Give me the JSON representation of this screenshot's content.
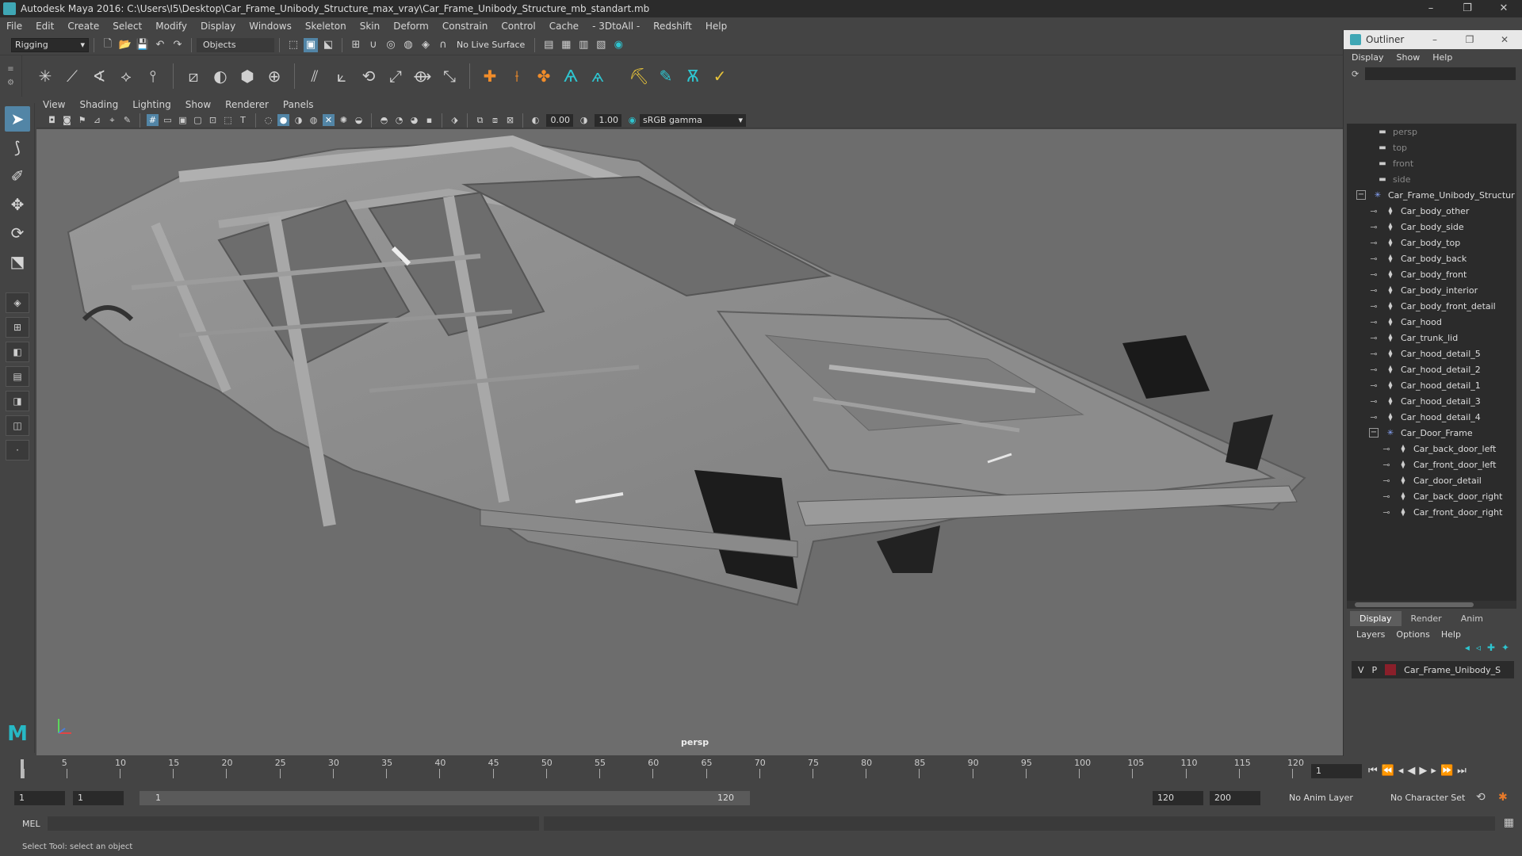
{
  "window": {
    "title": "Autodesk Maya 2016: C:\\Users\\I5\\Desktop\\Car_Frame_Unibody_Structure_max_vray\\Car_Frame_Unibody_Structure_mb_standart.mb",
    "minimize": "–",
    "maximize": "❐",
    "close": "✕"
  },
  "menubar": [
    "File",
    "Edit",
    "Create",
    "Select",
    "Modify",
    "Display",
    "Windows",
    "Skeleton",
    "Skin",
    "Deform",
    "Constrain",
    "Control",
    "Cache",
    "- 3DtoAll -",
    "Redshift",
    "Help"
  ],
  "statusline": {
    "menuset": "Rigging",
    "object_field": "Objects",
    "live_surface": "No Live Surface"
  },
  "viewport": {
    "menu": [
      "View",
      "Shading",
      "Lighting",
      "Show",
      "Renderer",
      "Panels"
    ],
    "gamma_value": "0.00",
    "exposure_value": "1.00",
    "color_space": "sRGB gamma",
    "camera_label": "persp"
  },
  "outliner": {
    "title": "Outliner",
    "menu": [
      "Display",
      "Show",
      "Help"
    ],
    "items": [
      {
        "label": "persp",
        "level": 0,
        "kind": "camera",
        "dim": true
      },
      {
        "label": "top",
        "level": 0,
        "kind": "camera",
        "dim": true
      },
      {
        "label": "front",
        "level": 0,
        "kind": "camera",
        "dim": true
      },
      {
        "label": "side",
        "level": 0,
        "kind": "camera",
        "dim": true
      },
      {
        "label": "Car_Frame_Unibody_Structur",
        "level": 0,
        "kind": "group",
        "dim": false
      },
      {
        "label": "Car_body_other",
        "level": 1,
        "kind": "mesh",
        "dim": false
      },
      {
        "label": "Car_body_side",
        "level": 1,
        "kind": "mesh",
        "dim": false
      },
      {
        "label": "Car_body_top",
        "level": 1,
        "kind": "mesh",
        "dim": false
      },
      {
        "label": "Car_body_back",
        "level": 1,
        "kind": "mesh",
        "dim": false
      },
      {
        "label": "Car_body_front",
        "level": 1,
        "kind": "mesh",
        "dim": false
      },
      {
        "label": "Car_body_interior",
        "level": 1,
        "kind": "mesh",
        "dim": false
      },
      {
        "label": "Car_body_front_detail",
        "level": 1,
        "kind": "mesh",
        "dim": false
      },
      {
        "label": "Car_hood",
        "level": 1,
        "kind": "mesh",
        "dim": false
      },
      {
        "label": "Car_trunk_lid",
        "level": 1,
        "kind": "mesh",
        "dim": false
      },
      {
        "label": "Car_hood_detail_5",
        "level": 1,
        "kind": "mesh",
        "dim": false
      },
      {
        "label": "Car_hood_detail_2",
        "level": 1,
        "kind": "mesh",
        "dim": false
      },
      {
        "label": "Car_hood_detail_1",
        "level": 1,
        "kind": "mesh",
        "dim": false
      },
      {
        "label": "Car_hood_detail_3",
        "level": 1,
        "kind": "mesh",
        "dim": false
      },
      {
        "label": "Car_hood_detail_4",
        "level": 1,
        "kind": "mesh",
        "dim": false
      },
      {
        "label": "Car_Door_Frame",
        "level": 1,
        "kind": "group",
        "dim": false
      },
      {
        "label": "Car_back_door_left",
        "level": 2,
        "kind": "mesh",
        "dim": false
      },
      {
        "label": "Car_front_door_left",
        "level": 2,
        "kind": "mesh",
        "dim": false
      },
      {
        "label": "Car_door_detail",
        "level": 2,
        "kind": "mesh",
        "dim": false
      },
      {
        "label": "Car_back_door_right",
        "level": 2,
        "kind": "mesh",
        "dim": false
      },
      {
        "label": "Car_front_door_right",
        "level": 2,
        "kind": "mesh",
        "dim": false
      }
    ]
  },
  "layers": {
    "tabs": [
      "Display",
      "Render",
      "Anim"
    ],
    "menu": [
      "Layers",
      "Options",
      "Help"
    ],
    "row": {
      "v": "V",
      "p": "P",
      "name": "Car_Frame_Unibody_S",
      "color": "#8a1f2a"
    }
  },
  "timeslider": {
    "ticks": [
      1,
      5,
      10,
      15,
      20,
      25,
      30,
      35,
      40,
      45,
      50,
      55,
      60,
      65,
      70,
      75,
      80,
      85,
      90,
      95,
      100,
      105,
      110,
      115,
      120
    ],
    "min": 1,
    "max": 120,
    "current_frame": "1"
  },
  "rangeslider": {
    "start": "1",
    "playback_start": "1",
    "range_label_start": "1",
    "range_label_end": "120",
    "playback_end": "120",
    "end": "200",
    "anim_layer": "No Anim Layer",
    "character_set": "No Character Set"
  },
  "cmdline": {
    "label": "MEL"
  },
  "helpline": {
    "text": "Select Tool: select an object"
  }
}
